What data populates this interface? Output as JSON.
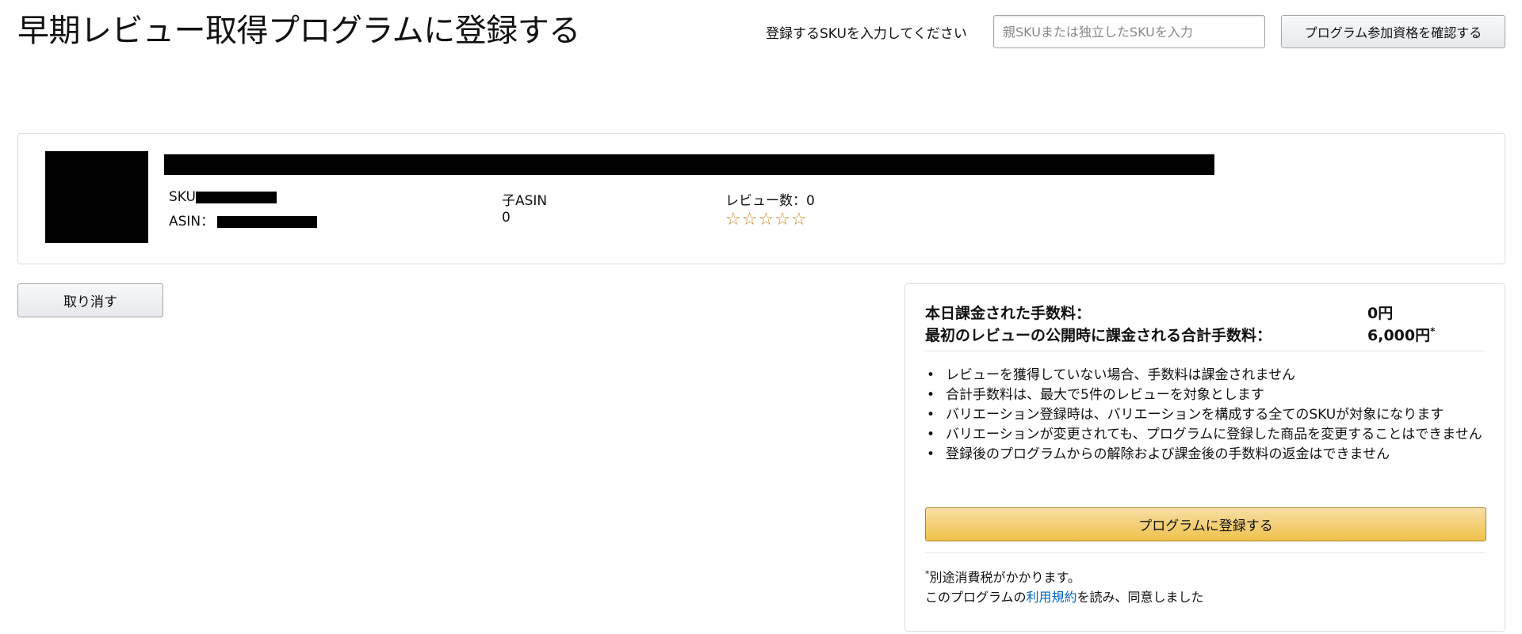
{
  "header": {
    "title": "早期レビュー取得プログラムに登録する",
    "sku_label": "登録するSKUを入力してください",
    "sku_input": {
      "value": "",
      "placeholder": "親SKUまたは独立したSKUを入力"
    },
    "check_button": "プログラム参加資格を確認する"
  },
  "product": {
    "sku_label": "SKU",
    "asin_label": "ASIN：",
    "child_asin_label": "子ASIN",
    "child_asin_value": "0",
    "review_count_text": "レビュー数：0",
    "stars": "☆☆☆☆☆",
    "rating": 0,
    "rating_max": 5
  },
  "cancel_button": "取り消す",
  "fees": {
    "today_label": "本日課金された手数料：",
    "today_value": "0円",
    "total_label": "最初のレビューの公開時に課金される合計手数料：",
    "total_value": "6,000円",
    "total_mark": "*",
    "notes": [
      "レビューを獲得していない場合、手数料は課金されません",
      "合計手数料は、最大で5件のレビューを対象とします",
      "バリエーション登録時は、バリエーションを構成する全てのSKUが対象になります",
      "バリエーションが変更されても、プログラムに登録した商品を変更することはできません",
      "登録後のプログラムからの解除および課金後の手数料の返金はできません"
    ],
    "enroll_button": "プログラムに登録する",
    "tax_mark": "*",
    "tax_note": "別途消費税がかかります。",
    "terms_prefix": "このプログラムの",
    "terms_link": "利用規約",
    "terms_suffix": "を読み、同意しました"
  }
}
